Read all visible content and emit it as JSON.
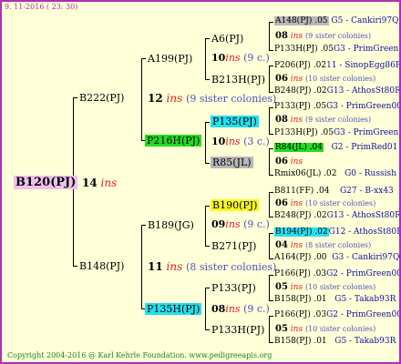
{
  "header_date": "9. 11-2016 ( 23: 30)",
  "footer": "Copyright 2004-2016 @ Karl Kehrle Foundation.   www.pedigreeapis.org",
  "colors": {
    "frame": "#b030b0",
    "background": "#ffffd8",
    "root_highlight": "#f0c0f0",
    "green": "#22dd22",
    "cyan": "#22e0f0",
    "yellow": "#f8f820",
    "gray": "#b8b8b8",
    "ins": "#e02020",
    "sisters": "#5050c0",
    "blue": "#1010a0"
  },
  "root": {
    "name": "B120(PJ)",
    "gen_num": "14",
    "gen_ins": "ins"
  },
  "g1": [
    {
      "name": "B222(PJ)",
      "gen_num": "12",
      "gen_ins": "ins",
      "sisters": "(9 sister colonies)"
    },
    {
      "name": "B148(PJ)",
      "gen_num": "11",
      "gen_ins": "ins",
      "sisters": "(8 sister colonies)"
    }
  ],
  "g2": [
    {
      "name": "A199(PJ)",
      "gen_num": "10",
      "gen_ins": "ins",
      "sisters": "(9 c.)"
    },
    {
      "name": "P216H(PJ)",
      "gen_num": "10",
      "gen_ins": "ins",
      "sisters": "(3 c.)"
    },
    {
      "name": "B189(JG)",
      "gen_num": "09",
      "gen_ins": "ins",
      "sisters": "(9 c.)"
    },
    {
      "name": "P135H(PJ)",
      "gen_num": "08",
      "gen_ins": "ins",
      "sisters": "(9 c.)"
    }
  ],
  "g3": [
    {
      "name": "A6(PJ)"
    },
    {
      "name": "B213H(PJ)"
    },
    {
      "name": "P135(PJ)"
    },
    {
      "name": "R85(JL)"
    },
    {
      "name": "B190(PJ)"
    },
    {
      "name": "B271(PJ)"
    },
    {
      "name": "P133(PJ)"
    },
    {
      "name": "P133H(PJ)"
    }
  ],
  "g4": [
    {
      "top": "A148(PJ) .05",
      "top_link": "G5 - Cankiri97Q",
      "num": "08",
      "ins": "ins",
      "sis": "(9 sister colonies)",
      "bottom": "P133H(PJ) .05",
      "bottom_link": "G3 - PrimGreen00"
    },
    {
      "top": "P206(PJ) .02",
      "top_link": "11 - SinopEgg86R",
      "num": "06",
      "ins": "ins",
      "sis": "(10 sister colonies)",
      "bottom": "B248(PJ) .02",
      "bottom_link": "G13 - AthosSt80R"
    },
    {
      "top": "P133(PJ) .05",
      "top_link": "G3 - PrimGreen00",
      "num": "08",
      "ins": "ins",
      "sis": "(9 sister colonies)",
      "bottom": "P133H(PJ) .05",
      "bottom_link": "G3 - PrimGreen00"
    },
    {
      "top": "R84(JL) .04",
      "top_link": "G2 - PrimRed01",
      "num": "06",
      "ins": "ins",
      "sis": "",
      "bottom": "Rmix06(JL) .02",
      "bottom_link": "G0 - Russish"
    },
    {
      "top": "B811(FF) .04",
      "top_link": "G27 - B-xx43",
      "num": "06",
      "ins": "ins",
      "sis": "(10 sister colonies)",
      "bottom": "B248(PJ) .02",
      "bottom_link": "G13 - AthosSt80R"
    },
    {
      "top": "B194(PJ) .02",
      "top_link": "G12 - AthosSt80R",
      "num": "04",
      "ins": "ins",
      "sis": "(8 sister colonies)",
      "bottom": "A164(PJ) .00",
      "bottom_link": "G3 - Cankiri97Q"
    },
    {
      "top": "P166(PJ) .03",
      "top_link": "G2 - PrimGreen00",
      "num": "05",
      "ins": "ins",
      "sis": "(10 sister colonies)",
      "bottom": "B158(PJ) .01",
      "bottom_link": "G5 - Takab93R"
    },
    {
      "top": "P166(PJ) .03",
      "top_link": "G2 - PrimGreen00",
      "num": "05",
      "ins": "ins",
      "sis": "(10 sister colonies)",
      "bottom": "B158(PJ) .01",
      "bottom_link": "G5 - Takab93R"
    }
  ]
}
